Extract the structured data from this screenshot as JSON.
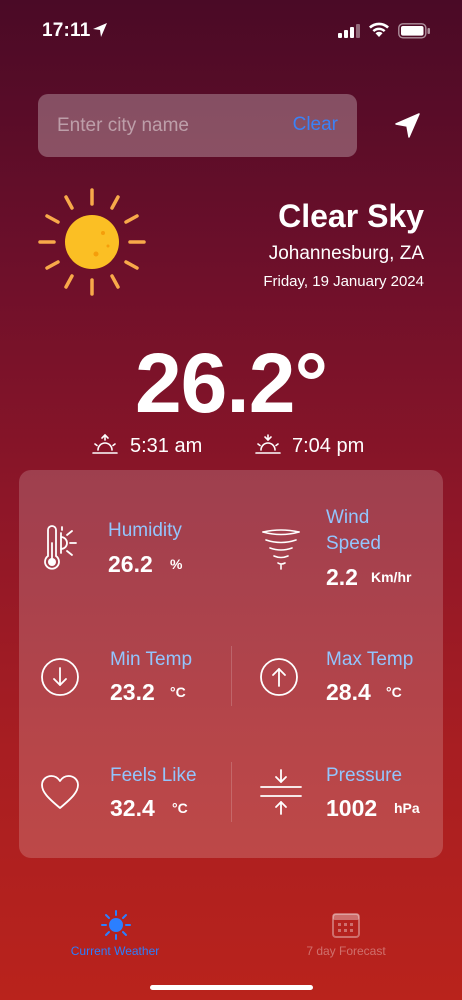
{
  "status_bar": {
    "time": "17:11"
  },
  "search": {
    "placeholder": "Enter city name",
    "value": "",
    "clear_label": "Clear"
  },
  "current": {
    "condition": "Clear Sky",
    "city": "Johannesburg, ZA",
    "date": "Friday, 19 January 2024",
    "temperature": "26.2°",
    "sunrise": "5:31  am",
    "sunset": "7:04  pm"
  },
  "metrics": {
    "humidity": {
      "label": "Humidity",
      "value": "26.2",
      "unit": "%"
    },
    "wind": {
      "label_line1": "Wind",
      "label_line2": "Speed",
      "value": "2.2",
      "unit": "Km/hr"
    },
    "min_temp": {
      "label": "Min Temp",
      "value": "23.2",
      "unit": "°C"
    },
    "max_temp": {
      "label": "Max Temp",
      "value": "28.4",
      "unit": "°C"
    },
    "feels_like": {
      "label": "Feels Like",
      "value": "32.4",
      "unit": "°C"
    },
    "pressure": {
      "label": "Pressure",
      "value": "1002",
      "unit": "hPa"
    }
  },
  "tabs": [
    {
      "label": "Current Weather",
      "icon": "sun-icon",
      "active": true
    },
    {
      "label": "7 day Forecast",
      "icon": "calendar-icon",
      "active": false
    }
  ],
  "colors": {
    "accent": "#2b7fff",
    "label_blue": "#93c5fd",
    "sun": "#fbbf24"
  }
}
